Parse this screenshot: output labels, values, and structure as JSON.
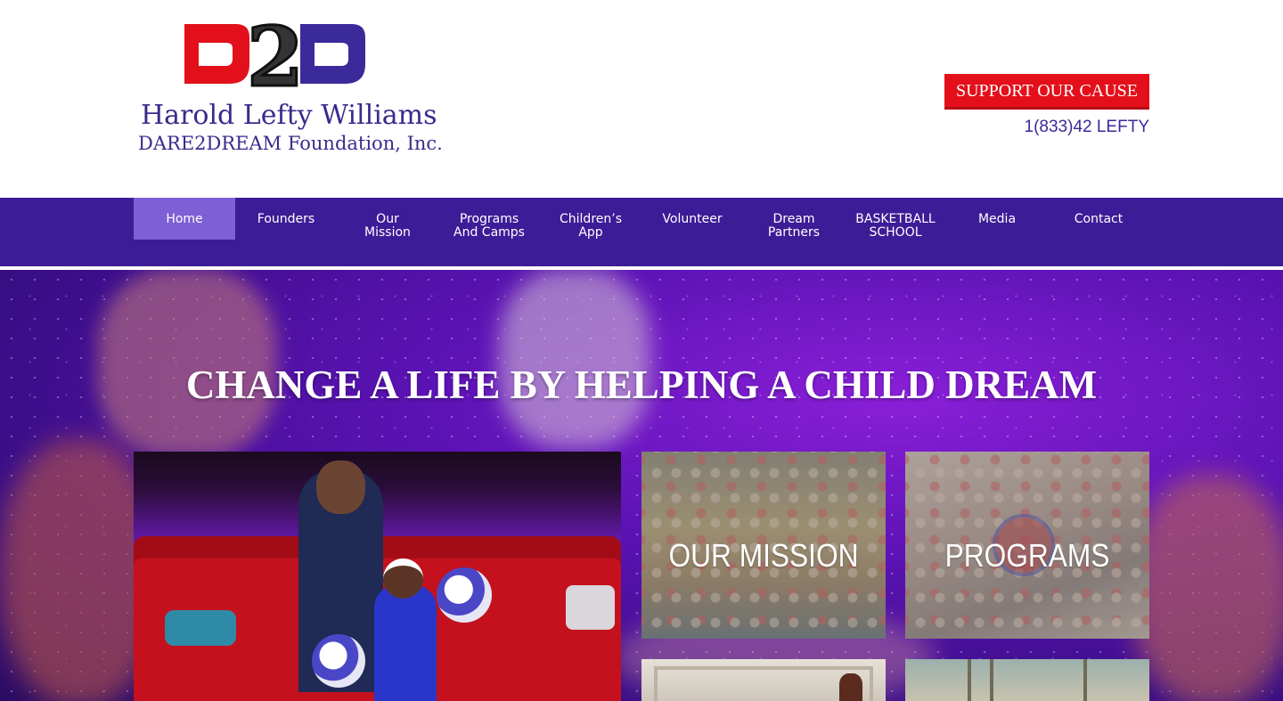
{
  "brand": {
    "logo_mark": "D2D",
    "line1": "Harold Lefty Williams",
    "line2": "DARE2DREAM Foundation, Inc.",
    "colors": {
      "red": "#e3101b",
      "purple": "#3b2a9a",
      "black": "#111111"
    }
  },
  "header": {
    "support_label": "SUPPORT OUR CAUSE",
    "phone": "1(833)42 LEFTY"
  },
  "nav": {
    "items": [
      {
        "label": "Home",
        "active": true
      },
      {
        "label": "Founders"
      },
      {
        "label": "Our Mission"
      },
      {
        "label": "Programs And Camps"
      },
      {
        "label": "Children’s App"
      },
      {
        "label": "Volunteer"
      },
      {
        "label": "Dream Partners"
      },
      {
        "label": "BASKETBALL SCHOOL"
      },
      {
        "label": "Media"
      },
      {
        "label": "Contact"
      }
    ],
    "colors": {
      "bar": "#3d1c97",
      "active": "#7d5fd6"
    }
  },
  "hero": {
    "title": "CHANGE A LIFE BY HELPING A CHILD DREAM"
  },
  "tiles": {
    "mission": "OUR MISSION",
    "programs": "PROGRAMS"
  }
}
